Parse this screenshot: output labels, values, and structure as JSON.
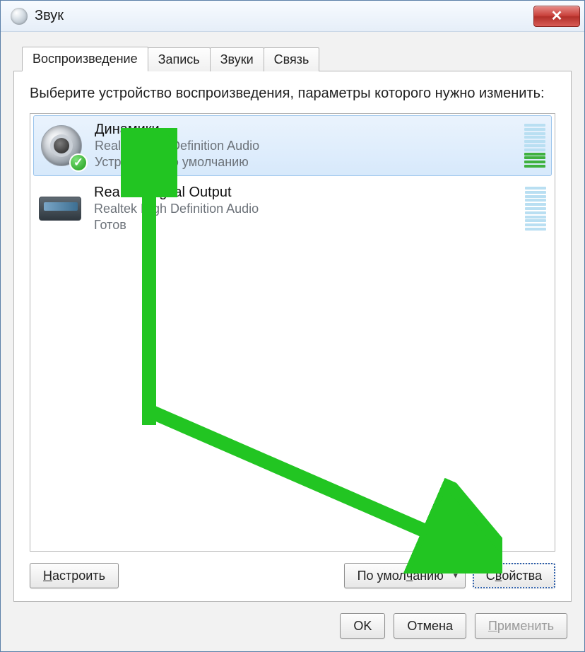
{
  "window": {
    "title": "Звук"
  },
  "titlebar": {
    "close_glyph": "✕"
  },
  "tabs": [
    {
      "label": "Воспроизведение",
      "active": true
    },
    {
      "label": "Запись",
      "active": false
    },
    {
      "label": "Звуки",
      "active": false
    },
    {
      "label": "Связь",
      "active": false
    }
  ],
  "instruction": "Выберите устройство воспроизведения, параметры которого нужно изменить:",
  "devices": [
    {
      "name": "Динамики",
      "sub1": "Realtek High Definition Audio",
      "sub2": "Устройство по умолчанию",
      "selected": true,
      "default_check": true,
      "vu_active": true,
      "icon": "speaker"
    },
    {
      "name": "Realtek Digital Output",
      "sub1": "Realtek High Definition Audio",
      "sub2": "Готов",
      "selected": false,
      "default_check": false,
      "vu_active": false,
      "icon": "spdif"
    }
  ],
  "panel_buttons": {
    "configure": {
      "pre": "",
      "hot": "Н",
      "post": "астроить"
    },
    "default": {
      "pre": "По умол",
      "hot": "ч",
      "post": "анию"
    },
    "properties": {
      "pre": "С",
      "hot": "в",
      "post": "ойства"
    }
  },
  "dialog_buttons": {
    "ok": "OK",
    "cancel": "Отмена",
    "apply": {
      "pre": "",
      "hot": "П",
      "post": "рименить"
    }
  },
  "annotations": {
    "arrow1": "points to selected device",
    "arrow2": "points to Properties button"
  }
}
